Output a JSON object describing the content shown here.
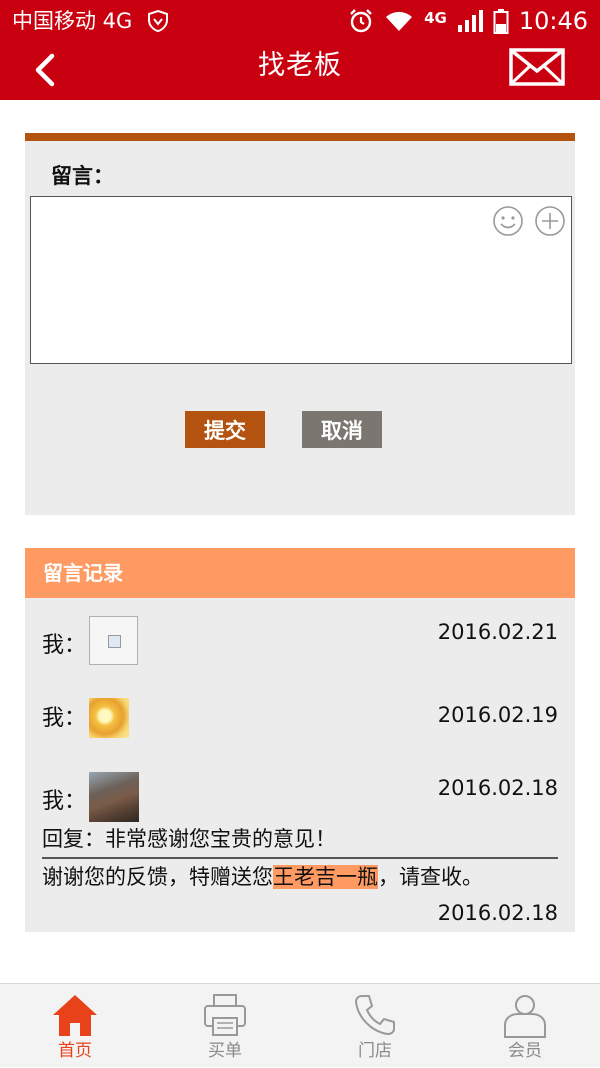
{
  "status_bar": {
    "carrier": "中国移动 4G",
    "network": "4G",
    "time": "10:46"
  },
  "header": {
    "title": "找老板",
    "back_icon": "chevron-left-icon",
    "mail_icon": "envelope-icon"
  },
  "message_form": {
    "label": "留言：",
    "input_value": "",
    "emoji_icon": "smiley-icon",
    "add_icon": "plus-circle-icon",
    "submit_label": "提交",
    "cancel_label": "取消"
  },
  "records": {
    "header": "留言记录",
    "items": [
      {
        "author": "我：",
        "date": "2016.02.21",
        "avatar": "broken-image"
      },
      {
        "author": "我：",
        "date": "2016.02.19",
        "avatar": "flower-thumbnail"
      },
      {
        "author": "我：",
        "date": "2016.02.18",
        "avatar": "photo-thumbnail"
      }
    ],
    "reply": {
      "text": "回复：非常感谢您宝贵的意见！",
      "thanks_prefix": "谢谢您的反馈，特赠送您",
      "gift": "王老吉一瓶",
      "thanks_suffix": "，请查收。",
      "date": "2016.02.18"
    }
  },
  "bottom_nav": {
    "items": [
      {
        "label": "首页",
        "icon": "home-icon",
        "active": true
      },
      {
        "label": "买单",
        "icon": "printer-icon",
        "active": false
      },
      {
        "label": "门店",
        "icon": "phone-icon",
        "active": false
      },
      {
        "label": "会员",
        "icon": "user-icon",
        "active": false
      }
    ]
  },
  "colors": {
    "brand_red": "#c90010",
    "accent_brown": "#b4520f",
    "records_orange": "#ff9b62",
    "active_nav": "#e8421a"
  }
}
